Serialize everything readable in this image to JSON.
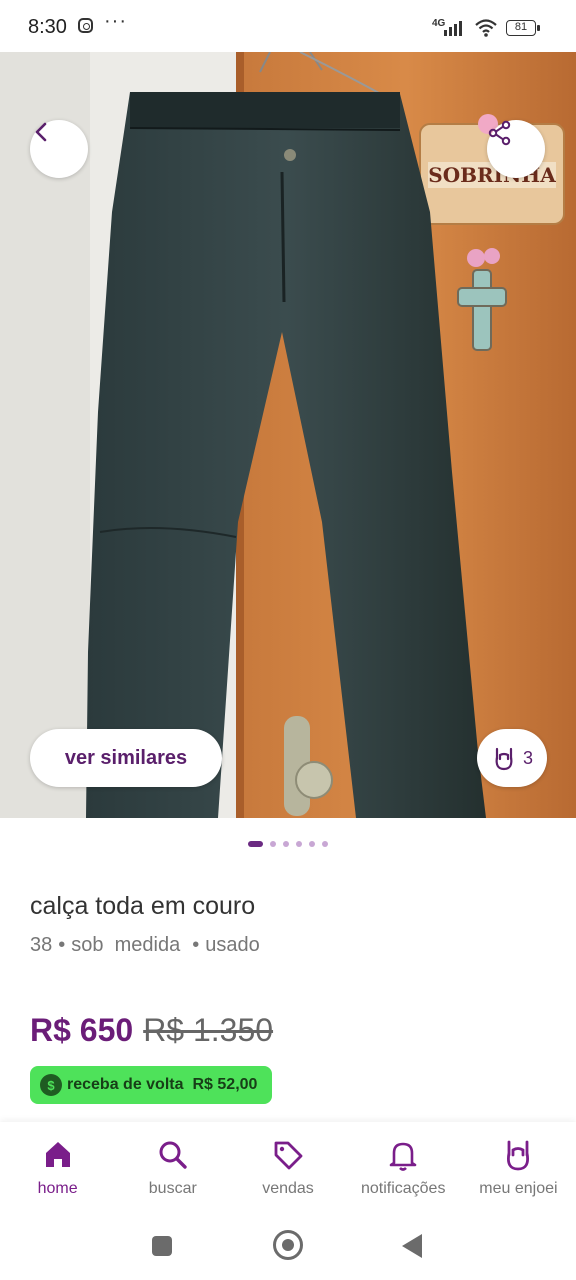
{
  "status_bar": {
    "time": "8:30",
    "more": "···",
    "network": "4G",
    "battery": "81"
  },
  "product": {
    "image_alt_icons": [
      "back-icon",
      "share-icon"
    ],
    "similar_button": "ver similares",
    "likes_count": "3",
    "pager": {
      "total": 6,
      "active": 0
    },
    "title": "calça toda em couro",
    "size": "38",
    "fit": "sob  medida",
    "condition": "usado",
    "separator": "•",
    "price": "R$ 650",
    "old_price": "R$ 1.350",
    "cashback_label": "receba de volta",
    "cashback_value": "R$ 52,00"
  },
  "bottom_nav": {
    "items": [
      {
        "label": "home",
        "icon": "home-icon",
        "active": true
      },
      {
        "label": "buscar",
        "icon": "search-icon",
        "active": false
      },
      {
        "label": "vendas",
        "icon": "tag-icon",
        "active": false
      },
      {
        "label": "notificações",
        "icon": "bell-icon",
        "active": false
      },
      {
        "label": "meu enjoei",
        "icon": "rock-hand-icon",
        "active": false
      }
    ]
  },
  "colors": {
    "brand": "#7a1e8a",
    "price": "#6b1d78",
    "cashback_bg": "#4ee25a"
  }
}
